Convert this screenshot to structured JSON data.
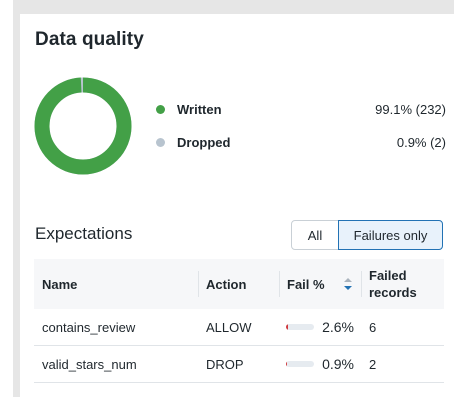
{
  "page": {
    "title": "Data quality"
  },
  "summary": {
    "items": [
      {
        "label": "Written",
        "value": "99.1% (232)",
        "color": "#43a047",
        "fraction": 0.991
      },
      {
        "label": "Dropped",
        "value": "0.9% (2)",
        "color": "#b8c4cf",
        "fraction": 0.009
      }
    ]
  },
  "expectations": {
    "title": "Expectations",
    "filters": {
      "all": "All",
      "failures": "Failures only",
      "selected": "failures"
    },
    "columns": {
      "name": "Name",
      "action": "Action",
      "fail_pct": "Fail %",
      "failed_records": "Failed\nrecords"
    },
    "sort_icon": "sort-icon",
    "rows": [
      {
        "name": "contains_review",
        "action": "ALLOW",
        "fail_pct": "2.6%",
        "fail_fraction": 0.026,
        "failed_records": "6"
      },
      {
        "name": "valid_stars_num",
        "action": "DROP",
        "fail_pct": "0.9%",
        "fail_fraction": 0.009,
        "failed_records": "2"
      }
    ]
  }
}
